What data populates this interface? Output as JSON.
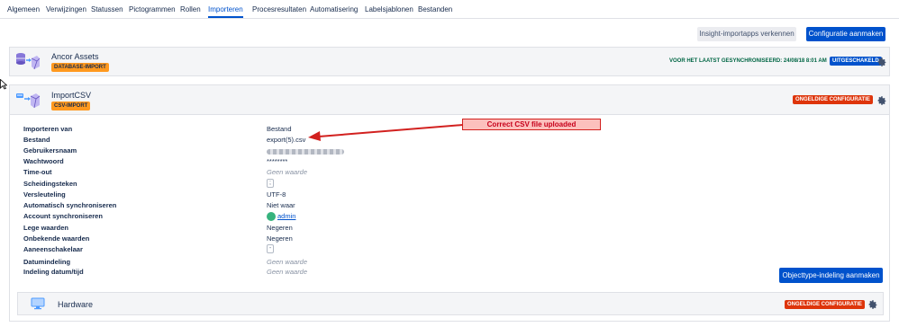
{
  "tabs": [
    {
      "label": "Algemeen"
    },
    {
      "label": "Verwijzingen"
    },
    {
      "label": "Statussen"
    },
    {
      "label": "Pictogrammen"
    },
    {
      "label": "Rollen"
    },
    {
      "label": "Importeren",
      "active": true
    },
    {
      "label": "Procesresultaten"
    },
    {
      "label": "Automatisering"
    },
    {
      "label": "Labelsjablonen"
    },
    {
      "label": "Bestanden"
    }
  ],
  "actions": {
    "explore_label": "Insight-importapps verkennen",
    "create_config_label": "Configuratie aanmaken"
  },
  "imports": [
    {
      "name": "Ancor Assets",
      "type_badge": "DATABASE-IMPORT",
      "last_sync": "VOOR HET LAATST GESYNCHRONISEERD: 24/08/18 8:01 AM",
      "status": "UITGESCHAKELD"
    },
    {
      "name": "ImportCSV",
      "type_badge": "CSV-IMPORT",
      "status": "ONGELDIGE CONFIGURATIE",
      "properties": [
        {
          "label": "Importeren van",
          "value": "Bestand"
        },
        {
          "label": "Bestand",
          "value": "export(5).csv"
        },
        {
          "label": "Gebruikersnaam",
          "value": ""
        },
        {
          "label": "Wachtwoord",
          "value": "********"
        },
        {
          "label": "Time-out",
          "value": "Geen waarde"
        },
        {
          "label": "Scheidingsteken",
          "value": ";"
        },
        {
          "label": "Versleuteling",
          "value": "UTF-8"
        },
        {
          "label": "Automatisch synchroniseren",
          "value": "Niet waar"
        },
        {
          "label": "Account synchroniseren",
          "value": "admin"
        },
        {
          "label": "Lege waarden",
          "value": "Negeren"
        },
        {
          "label": "Onbekende waarden",
          "value": "Negeren"
        },
        {
          "label": "Aaneenschakelaar",
          "value": "-"
        },
        {
          "label": "Datumindeling",
          "value": "Geen waarde"
        },
        {
          "label": "Indeling datum/tijd",
          "value": "Geen waarde"
        }
      ],
      "object_type_button": "Objecttype-indeling aanmaken",
      "sub_items": [
        {
          "name": "Hardware",
          "status": "ONGELDIGE CONFIGURATIE"
        }
      ]
    }
  ],
  "annotation": {
    "text": "Correct CSV file uploaded",
    "color": "#d2211f"
  },
  "colors": {
    "primary": "#0052cc",
    "danger": "#de350b",
    "warning": "#ff991f",
    "success": "#006644"
  }
}
